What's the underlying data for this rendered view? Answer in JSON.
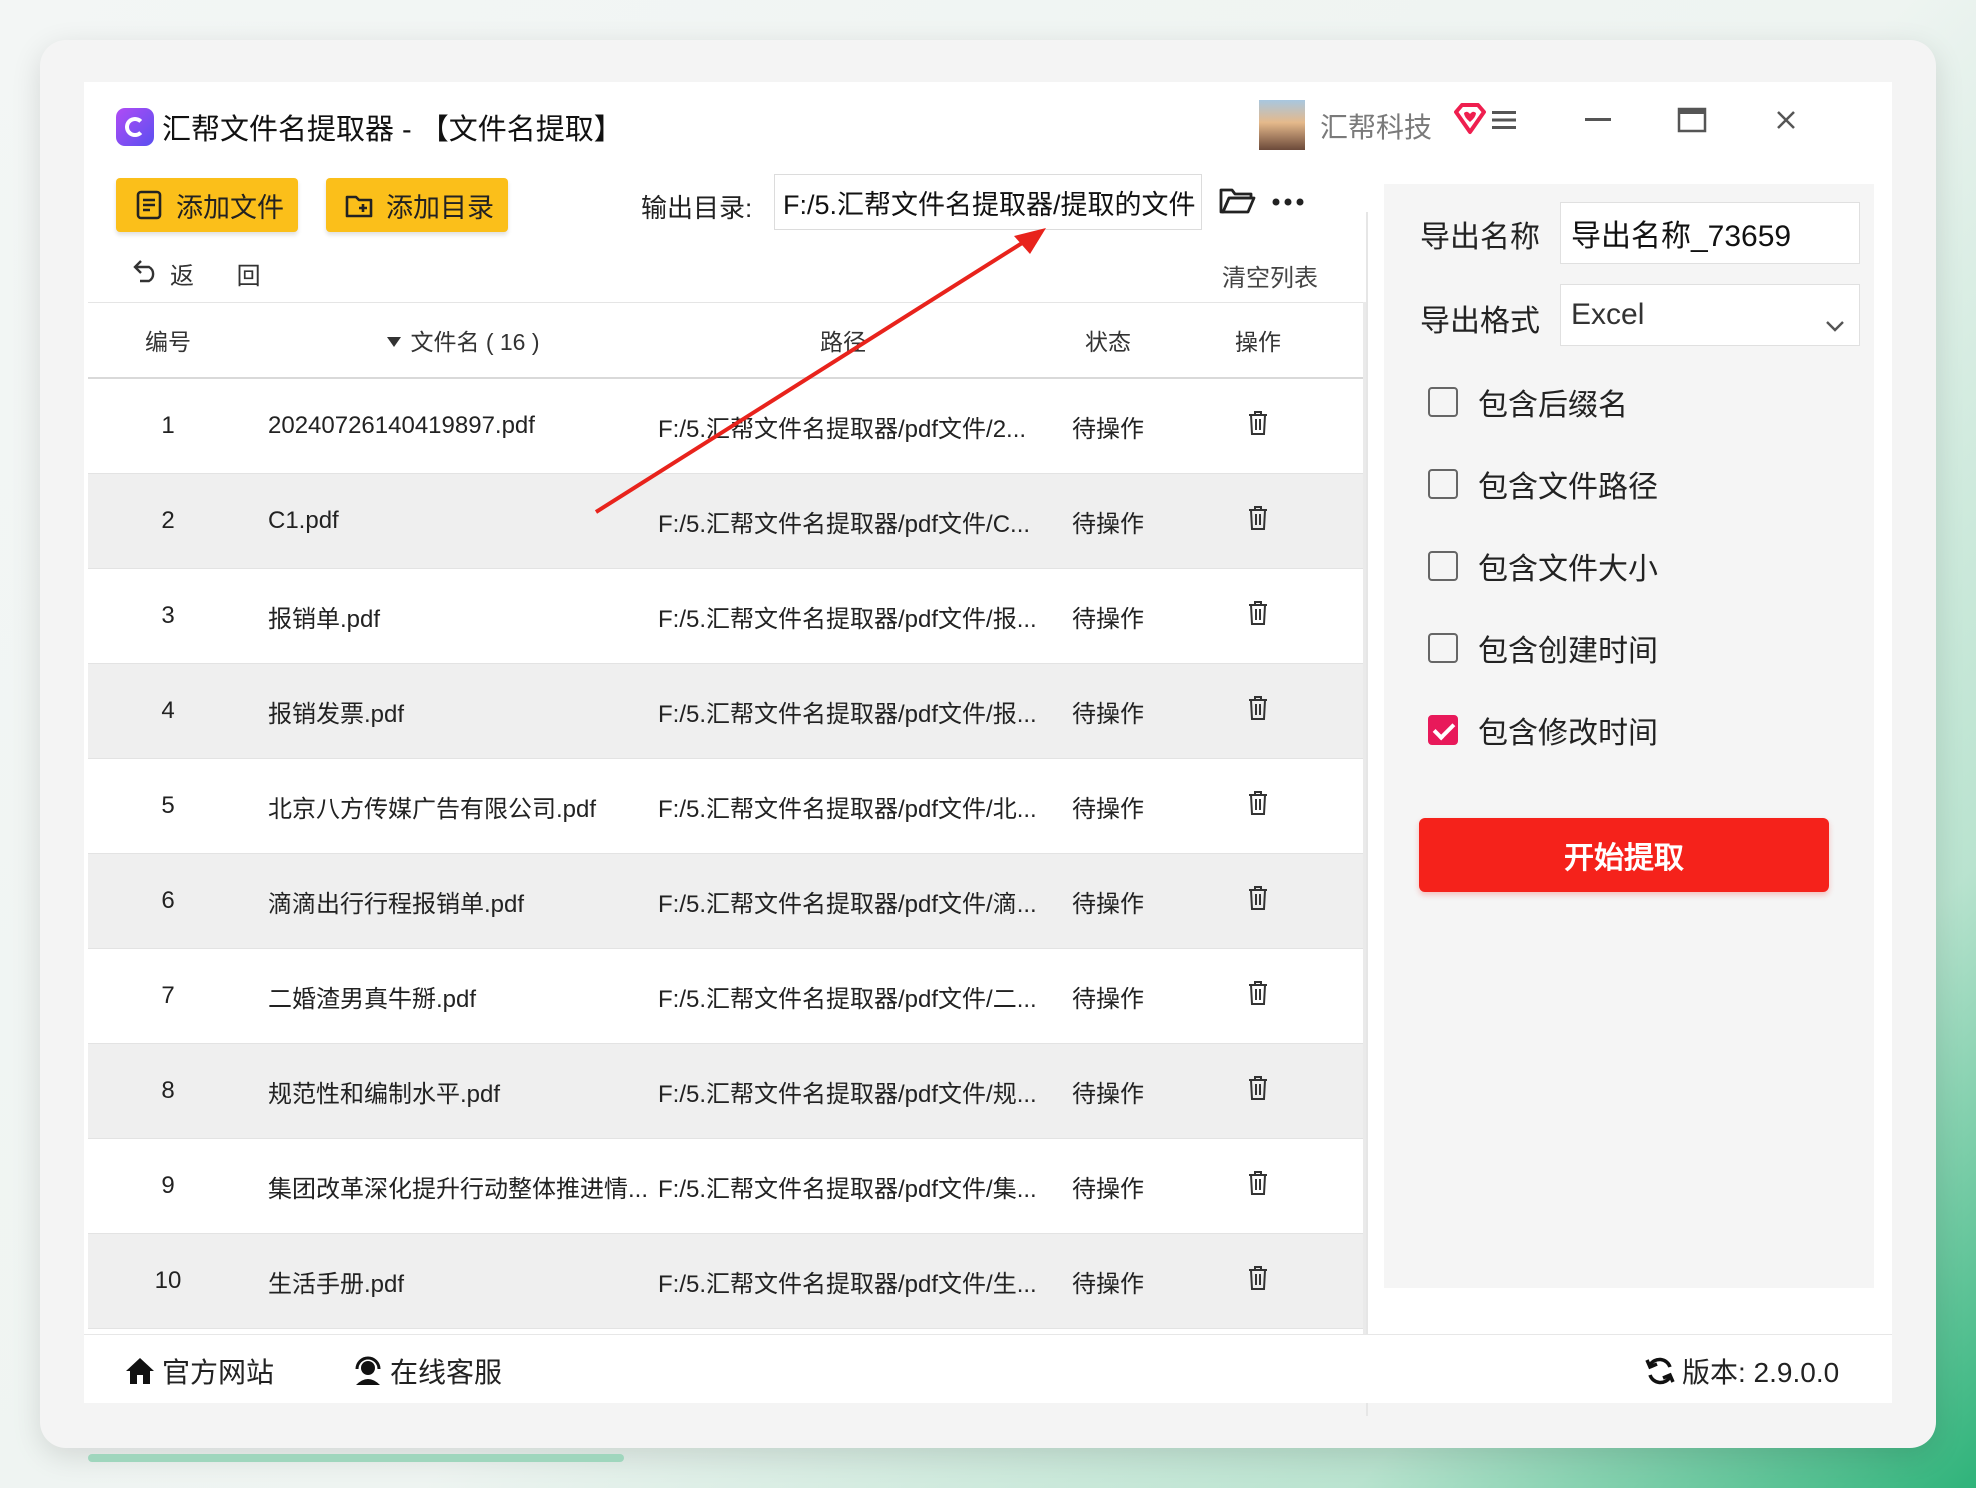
{
  "window": {
    "app_title": "汇帮文件名提取器 - 【文件名提取】",
    "company": "汇帮科技"
  },
  "toolbar": {
    "add_file_label": "添加文件",
    "add_dir_label": "添加目录",
    "output_label": "输出目录:",
    "output_path": "F:/5.汇帮文件名提取器/提取的文件",
    "back_label": "返 回",
    "clear_label": "清空列表"
  },
  "table": {
    "headers": {
      "num": "编号",
      "name": "文件名 ( 16 )",
      "path": "路径",
      "status": "状态",
      "op": "操作"
    },
    "rows": [
      {
        "num": "1",
        "name": "20240726140419897.pdf",
        "path": "F:/5.汇帮文件名提取器/pdf文件/2...",
        "status": "待操作"
      },
      {
        "num": "2",
        "name": "C1.pdf",
        "path": "F:/5.汇帮文件名提取器/pdf文件/C...",
        "status": "待操作"
      },
      {
        "num": "3",
        "name": "报销单.pdf",
        "path": "F:/5.汇帮文件名提取器/pdf文件/报...",
        "status": "待操作"
      },
      {
        "num": "4",
        "name": "报销发票.pdf",
        "path": "F:/5.汇帮文件名提取器/pdf文件/报...",
        "status": "待操作"
      },
      {
        "num": "5",
        "name": "北京八方传媒广告有限公司.pdf",
        "path": "F:/5.汇帮文件名提取器/pdf文件/北...",
        "status": "待操作"
      },
      {
        "num": "6",
        "name": "滴滴出行行程报销单.pdf",
        "path": "F:/5.汇帮文件名提取器/pdf文件/滴...",
        "status": "待操作"
      },
      {
        "num": "7",
        "name": "二婚渣男真牛掰.pdf",
        "path": "F:/5.汇帮文件名提取器/pdf文件/二...",
        "status": "待操作"
      },
      {
        "num": "8",
        "name": "规范性和编制水平.pdf",
        "path": "F:/5.汇帮文件名提取器/pdf文件/规...",
        "status": "待操作"
      },
      {
        "num": "9",
        "name": "集团改革深化提升行动整体推进情...",
        "path": "F:/5.汇帮文件名提取器/pdf文件/集...",
        "status": "待操作"
      },
      {
        "num": "10",
        "name": "生活手册.pdf",
        "path": "F:/5.汇帮文件名提取器/pdf文件/生...",
        "status": "待操作"
      }
    ]
  },
  "panel": {
    "export_name_label": "导出名称",
    "export_name_value": "导出名称_73659",
    "export_format_label": "导出格式",
    "export_format_value": "Excel",
    "options": [
      {
        "label": "包含后缀名",
        "checked": false
      },
      {
        "label": "包含文件路径",
        "checked": false
      },
      {
        "label": "包含文件大小",
        "checked": false
      },
      {
        "label": "包含创建时间",
        "checked": false
      },
      {
        "label": "包含修改时间",
        "checked": true
      }
    ],
    "start_label": "开始提取"
  },
  "footer": {
    "website_label": "官方网站",
    "support_label": "在线客服",
    "version_label": "版本: 2.9.0.0"
  },
  "colors": {
    "accent_yellow": "#fbbf1a",
    "start_red": "#f5221b",
    "check_pink": "#e8195a",
    "arrow_red": "#e8231c"
  },
  "icons": {
    "add_file": "file-list-icon",
    "add_dir": "folder-add-icon",
    "browse": "folder-icon",
    "more": "more-dots-icon",
    "back": "undo-arrow-icon",
    "delete": "trash-icon",
    "sort": "sort-down-icon",
    "menu": "hamburger-icon",
    "minimize": "minimize-icon",
    "maximize": "maximize-icon",
    "close": "close-icon",
    "vip": "diamond-heart-icon",
    "home": "home-icon",
    "support": "headset-icon",
    "refresh": "refresh-icon"
  }
}
